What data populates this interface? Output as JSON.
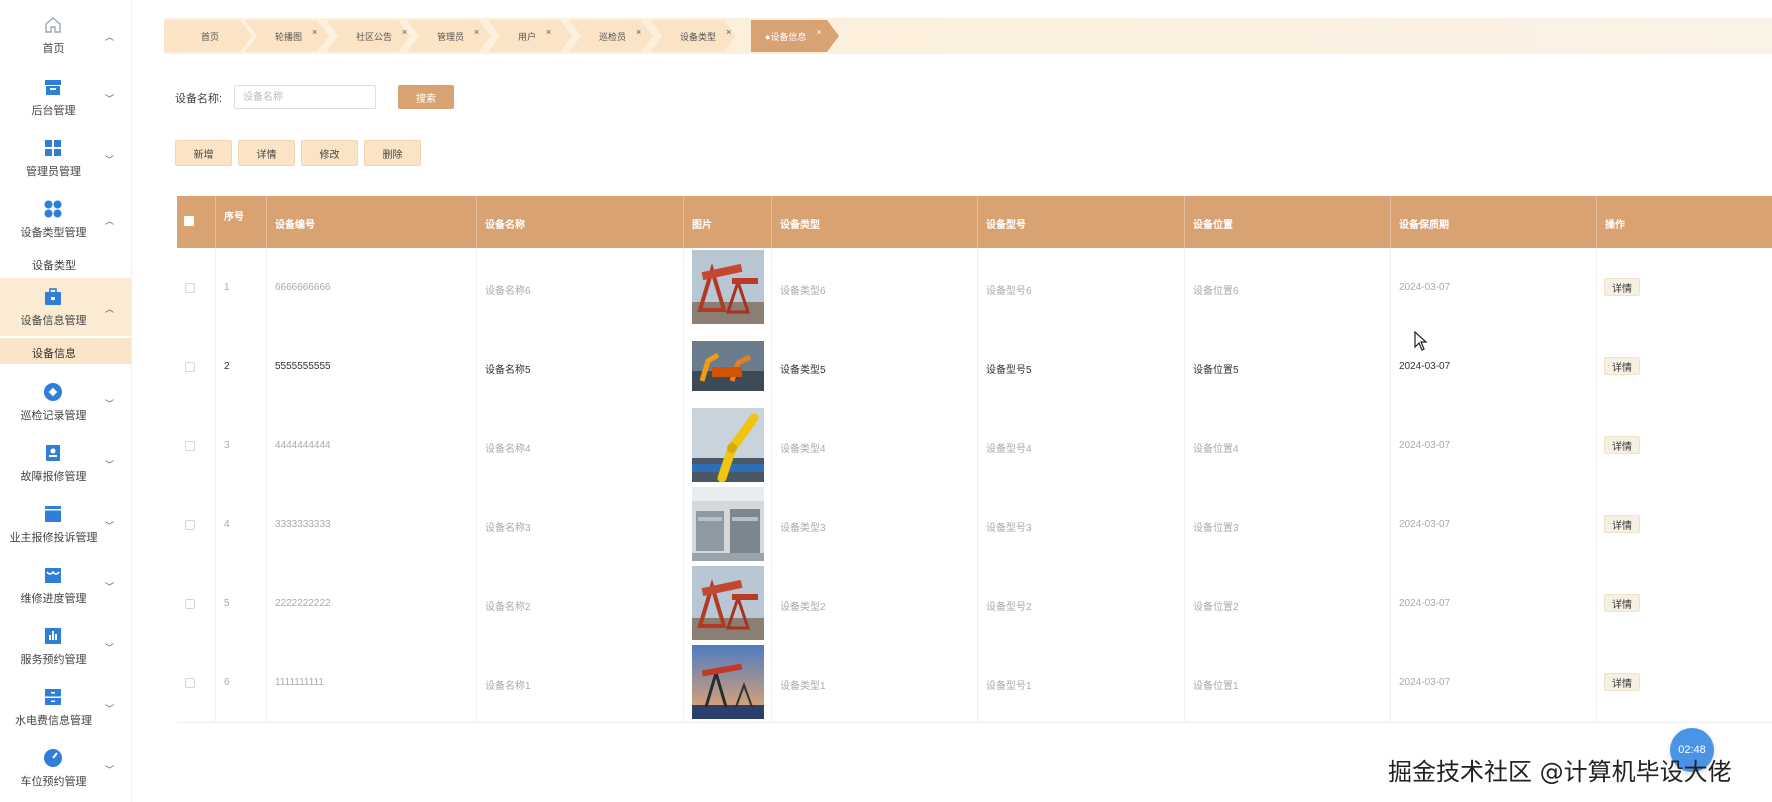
{
  "sidebar": {
    "items": [
      {
        "label": "首页",
        "icon": "home-icon"
      },
      {
        "label": "后台管理",
        "icon": "archive-icon"
      },
      {
        "label": "管理员管理",
        "icon": "grid-icon"
      },
      {
        "label": "设备类型管理",
        "icon": "apps-icon",
        "sub": "设备类型"
      },
      {
        "label": "设备信息管理",
        "icon": "briefcase-icon",
        "sub": "设备信息"
      },
      {
        "label": "巡检记录管理",
        "icon": "diamond-icon"
      },
      {
        "label": "故障报修管理",
        "icon": "contact-card-icon"
      },
      {
        "label": "业主报修投诉管理",
        "icon": "panel-icon"
      },
      {
        "label": "维修进度管理",
        "icon": "store-icon"
      },
      {
        "label": "服务预约管理",
        "icon": "bar-chart-icon"
      },
      {
        "label": "水电费信息管理",
        "icon": "cabinet-icon"
      },
      {
        "label": "车位预约管理",
        "icon": "gauge-icon"
      }
    ]
  },
  "tabs": [
    {
      "label": "首页"
    },
    {
      "label": "轮播图"
    },
    {
      "label": "社区公告"
    },
    {
      "label": "管理员"
    },
    {
      "label": "用户"
    },
    {
      "label": "巡检员"
    },
    {
      "label": "设备类型"
    },
    {
      "label": "●设备信息"
    }
  ],
  "tab_close": "×",
  "search": {
    "label": "设备名称:",
    "placeholder": "设备名称",
    "button": "搜索"
  },
  "actions": {
    "add": "新增",
    "detail": "详情",
    "edit": "修改",
    "delete": "删除"
  },
  "table": {
    "headers": [
      "序号",
      "设备编号",
      "设备名称",
      "图片",
      "设备类型",
      "设备型号",
      "设备位置",
      "设备保质期",
      "操作"
    ],
    "rows": [
      {
        "no": "1",
        "code": "6666666666",
        "name": "设备名称6",
        "type": "设备类型6",
        "model": "设备型号6",
        "location": "设备位置6",
        "warranty": "2024-03-07",
        "action": "详情",
        "image": "oil-pump"
      },
      {
        "no": "2",
        "code": "5555555555",
        "name": "设备名称5",
        "type": "设备类型5",
        "model": "设备型号5",
        "location": "设备位置5",
        "warranty": "2024-03-07",
        "action": "详情",
        "image": "robot-line"
      },
      {
        "no": "3",
        "code": "4444444444",
        "name": "设备名称4",
        "type": "设备类型4",
        "model": "设备型号4",
        "location": "设备位置4",
        "warranty": "2024-03-07",
        "action": "详情",
        "image": "yellow-robot"
      },
      {
        "no": "4",
        "code": "3333333333",
        "name": "设备名称3",
        "type": "设备类型3",
        "model": "设备型号3",
        "location": "设备位置3",
        "warranty": "2024-03-07",
        "action": "详情",
        "image": "factory-floor"
      },
      {
        "no": "5",
        "code": "2222222222",
        "name": "设备名称2",
        "type": "设备类型2",
        "model": "设备型号2",
        "location": "设备位置2",
        "warranty": "2024-03-07",
        "action": "详情",
        "image": "oil-pump"
      },
      {
        "no": "6",
        "code": "1111111111",
        "name": "设备名称1",
        "type": "设备类型1",
        "model": "设备型号1",
        "location": "设备位置1",
        "warranty": "2024-03-07",
        "action": "详情",
        "image": "oil-pump-sky"
      }
    ]
  },
  "timer": "02:48",
  "watermark": "掘金技术社区 @计算机毕设大佬",
  "colors": {
    "accent": "#d9a273",
    "tab_bg": "#fbe4c6",
    "active_menu": "#fcebd3",
    "icon_blue": "#2f7fd8"
  }
}
